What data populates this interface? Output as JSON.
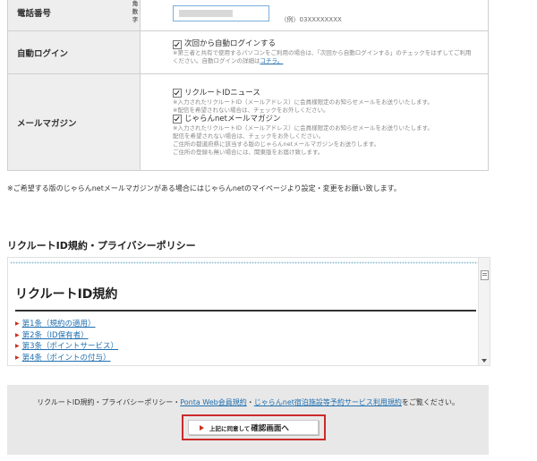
{
  "form": {
    "phone": {
      "label": "電話番号",
      "sublabel_1": "半角",
      "sublabel_2": "数字",
      "value": "",
      "example": "（例）03XXXXXXXX"
    },
    "auto_login": {
      "label": "自動ログイン",
      "checkbox_label": "次回から自動ログインする",
      "note_1": "※第三者と共有で使用するパソコンをご利用の場合は、「次回から自動ログインする」のチェックをはずしてご利用",
      "note_2": "ください。自動ログインの詳細は",
      "note_link": "コチラ。",
      "checked": true
    },
    "mail_magazine": {
      "label": "メールマガジン",
      "recruit_news_label": "リクルートIDニュース",
      "recruit_news_note_1": "※入力されたリクルートID（メールアドレス）に会員様限定のお知らせメールをお送りいたします。",
      "recruit_news_note_2": "※配信を希望されない場合は、チェックをお外しください。",
      "jalan_label": "じゃらんnetメールマガジン",
      "jalan_note_1": "※入力されたリクルートID（メールアドレス）に会員様限定のお知らせメールをお送りいたします。",
      "jalan_note_2": "配信を希望されない場合は、チェックをお外しください。",
      "jalan_note_3": "ご住所の都道府県に該当する版のじゃらんnetメールマガジンをお送りします。",
      "jalan_note_4": "ご住所の登録も無い場合には、関東版をお届け致します。"
    }
  },
  "footnote": "※ご希望する版のじゃらんnetメールマガジンがある場合にはじゃらんnetのマイページより設定・変更をお願い致します。",
  "section_title": "リクルートID規約・プライバシーポリシー",
  "terms": {
    "heading": "リクルートID規約",
    "items": [
      "第1条（規約の適用）",
      "第2条（ID保有者）",
      "第3条（ポイントサービス）",
      "第4条（ポイントの付与）"
    ]
  },
  "agree": {
    "text_prefix": "リクルートID規約・プライバシーポリシー・",
    "link_ponta": "Ponta Web会員規約",
    "separator": "・",
    "link_jalan": "じゃらんnet宿泊施設等予約サービス利用規約",
    "text_suffix": "をご覧ください。",
    "button_prefix": "上記に同意して",
    "button_label": "確認画面へ"
  },
  "colors": {
    "link": "#1f6fb0",
    "highlight_frame": "#cc2a2a",
    "label_bg": "#eeeeee"
  }
}
